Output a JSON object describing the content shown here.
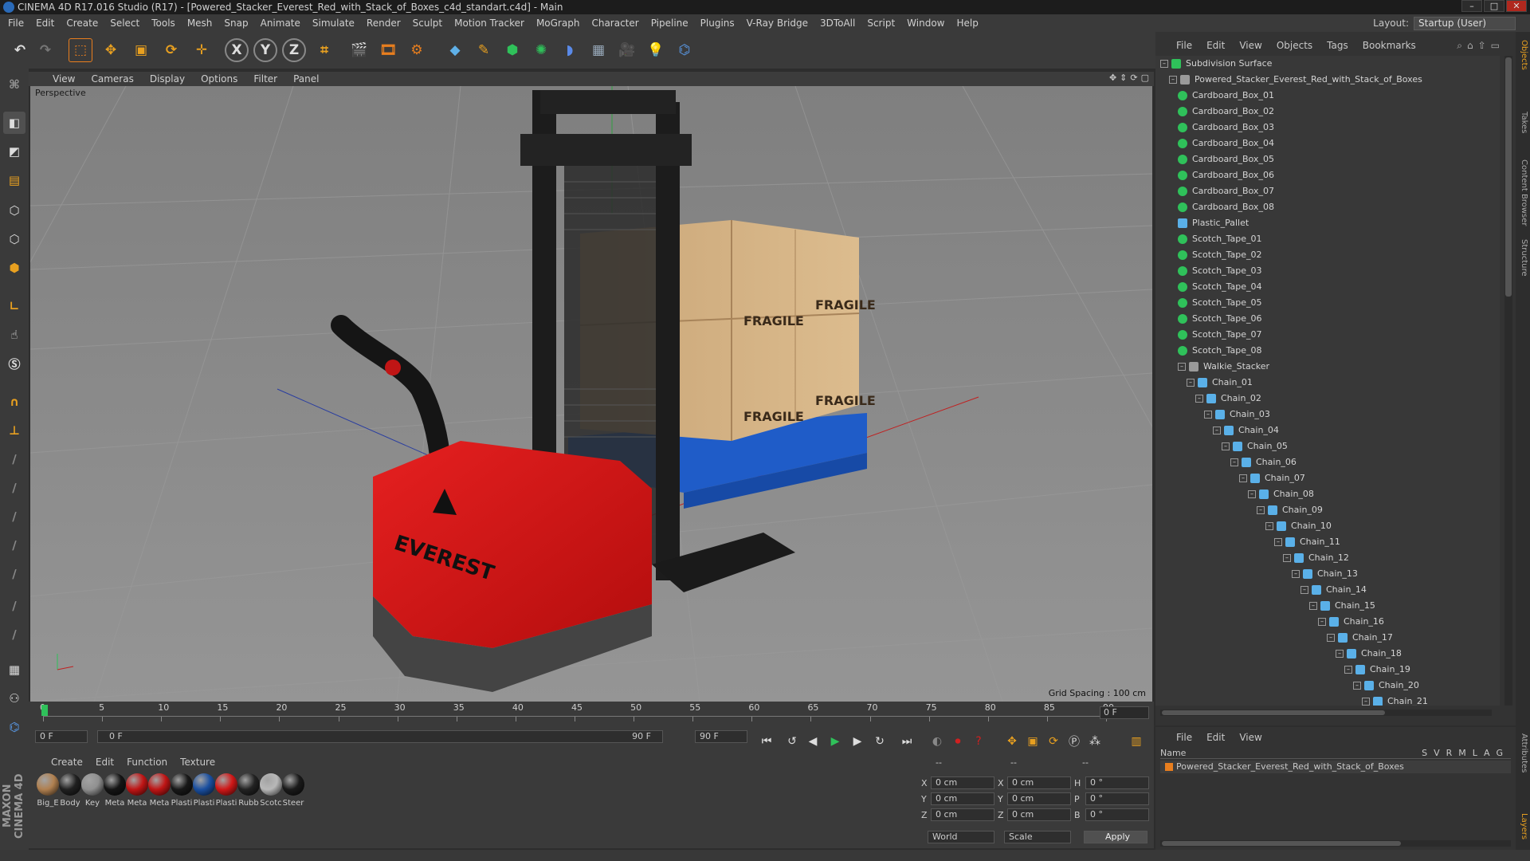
{
  "window": {
    "title": "CINEMA 4D R17.016 Studio (R17) - [Powered_Stacker_Everest_Red_with_Stack_of_Boxes_c4d_standart.c4d] - Main"
  },
  "menu": [
    "File",
    "Edit",
    "Create",
    "Select",
    "Tools",
    "Mesh",
    "Snap",
    "Animate",
    "Simulate",
    "Render",
    "Sculpt",
    "Motion Tracker",
    "MoGraph",
    "Character",
    "Pipeline",
    "Plugins",
    "V-Ray Bridge",
    "3DToAll",
    "Script",
    "Window",
    "Help"
  ],
  "layout": {
    "label": "Layout:",
    "value": "Startup (User)"
  },
  "toolbar": {
    "axis_x": "X",
    "axis_y": "Y",
    "axis_z": "Z"
  },
  "viewport": {
    "menu": [
      "View",
      "Cameras",
      "Display",
      "Options",
      "Filter",
      "Panel"
    ],
    "label": "Perspective",
    "grid_spacing": "Grid Spacing : 100 cm",
    "box_label": "FRAGILE",
    "brand": "EVEREST"
  },
  "timeline": {
    "ticks": [
      "0",
      "5",
      "10",
      "15",
      "20",
      "25",
      "30",
      "35",
      "40",
      "45",
      "50",
      "55",
      "60",
      "65",
      "70",
      "75",
      "80",
      "85",
      "90"
    ],
    "frame": "0 F"
  },
  "transport": {
    "start": "0 F",
    "range_start": "0 F",
    "range_end": "90 F",
    "end": "90 F"
  },
  "materials": {
    "menu": [
      "Create",
      "Edit",
      "Function",
      "Texture"
    ],
    "items": [
      {
        "label": "Big_E",
        "color": "#b08050"
      },
      {
        "label": "Body",
        "color": "#202020"
      },
      {
        "label": "Key",
        "color": "#909090"
      },
      {
        "label": "Meta",
        "color": "#151515"
      },
      {
        "label": "Meta",
        "color": "#c01515"
      },
      {
        "label": "Meta",
        "color": "#c01515"
      },
      {
        "label": "Plasti",
        "color": "#181818"
      },
      {
        "label": "Plasti",
        "color": "#1a4fa0"
      },
      {
        "label": "Plasti",
        "color": "#d01818"
      },
      {
        "label": "Rubb",
        "color": "#222222"
      },
      {
        "label": "Scotc",
        "color": "#b8b8b8"
      },
      {
        "label": "Steer",
        "color": "#1a1a1a"
      }
    ]
  },
  "coords": {
    "header": [
      "--",
      "--",
      "--"
    ],
    "rows": [
      {
        "a": "X",
        "av": "0 cm",
        "b": "X",
        "bv": "0 cm",
        "c": "H",
        "cv": "0 °"
      },
      {
        "a": "Y",
        "av": "0 cm",
        "b": "Y",
        "bv": "0 cm",
        "c": "P",
        "cv": "0 °"
      },
      {
        "a": "Z",
        "av": "0 cm",
        "b": "Z",
        "bv": "0 cm",
        "c": "B",
        "cv": "0 °"
      }
    ],
    "world": "World",
    "scale": "Scale",
    "apply": "Apply"
  },
  "objects": {
    "menu": [
      "File",
      "Edit",
      "View",
      "Objects",
      "Tags",
      "Bookmarks"
    ],
    "items": [
      {
        "label": "Subdivision Surface",
        "depth": 0,
        "icon": "sds"
      },
      {
        "label": "Powered_Stacker_Everest_Red_with_Stack_of_Boxes",
        "depth": 1,
        "icon": "null"
      },
      {
        "label": "Cardboard_Box_01",
        "depth": 2,
        "icon": "poly"
      },
      {
        "label": "Cardboard_Box_02",
        "depth": 2,
        "icon": "poly"
      },
      {
        "label": "Cardboard_Box_03",
        "depth": 2,
        "icon": "poly"
      },
      {
        "label": "Cardboard_Box_04",
        "depth": 2,
        "icon": "poly"
      },
      {
        "label": "Cardboard_Box_05",
        "depth": 2,
        "icon": "poly"
      },
      {
        "label": "Cardboard_Box_06",
        "depth": 2,
        "icon": "poly"
      },
      {
        "label": "Cardboard_Box_07",
        "depth": 2,
        "icon": "poly"
      },
      {
        "label": "Cardboard_Box_08",
        "depth": 2,
        "icon": "poly"
      },
      {
        "label": "Plastic_Pallet",
        "depth": 2,
        "icon": "bone"
      },
      {
        "label": "Scotch_Tape_01",
        "depth": 2,
        "icon": "poly"
      },
      {
        "label": "Scotch_Tape_02",
        "depth": 2,
        "icon": "poly"
      },
      {
        "label": "Scotch_Tape_03",
        "depth": 2,
        "icon": "poly"
      },
      {
        "label": "Scotch_Tape_04",
        "depth": 2,
        "icon": "poly"
      },
      {
        "label": "Scotch_Tape_05",
        "depth": 2,
        "icon": "poly"
      },
      {
        "label": "Scotch_Tape_06",
        "depth": 2,
        "icon": "poly"
      },
      {
        "label": "Scotch_Tape_07",
        "depth": 2,
        "icon": "poly"
      },
      {
        "label": "Scotch_Tape_08",
        "depth": 2,
        "icon": "poly"
      },
      {
        "label": "Walkie_Stacker",
        "depth": 2,
        "icon": "null"
      },
      {
        "label": "Chain_01",
        "depth": 3,
        "icon": "bone"
      },
      {
        "label": "Chain_02",
        "depth": 4,
        "icon": "bone"
      },
      {
        "label": "Chain_03",
        "depth": 5,
        "icon": "bone"
      },
      {
        "label": "Chain_04",
        "depth": 6,
        "icon": "bone"
      },
      {
        "label": "Chain_05",
        "depth": 7,
        "icon": "bone"
      },
      {
        "label": "Chain_06",
        "depth": 8,
        "icon": "bone"
      },
      {
        "label": "Chain_07",
        "depth": 9,
        "icon": "bone"
      },
      {
        "label": "Chain_08",
        "depth": 10,
        "icon": "bone"
      },
      {
        "label": "Chain_09",
        "depth": 11,
        "icon": "bone"
      },
      {
        "label": "Chain_10",
        "depth": 12,
        "icon": "bone"
      },
      {
        "label": "Chain_11",
        "depth": 13,
        "icon": "bone"
      },
      {
        "label": "Chain_12",
        "depth": 14,
        "icon": "bone"
      },
      {
        "label": "Chain_13",
        "depth": 15,
        "icon": "bone"
      },
      {
        "label": "Chain_14",
        "depth": 16,
        "icon": "bone"
      },
      {
        "label": "Chain_15",
        "depth": 17,
        "icon": "bone"
      },
      {
        "label": "Chain_16",
        "depth": 18,
        "icon": "bone"
      },
      {
        "label": "Chain_17",
        "depth": 19,
        "icon": "bone"
      },
      {
        "label": "Chain_18",
        "depth": 20,
        "icon": "bone"
      },
      {
        "label": "Chain_19",
        "depth": 21,
        "icon": "bone"
      },
      {
        "label": "Chain_20",
        "depth": 22,
        "icon": "bone"
      },
      {
        "label": "Chain_21",
        "depth": 23,
        "icon": "bone"
      }
    ]
  },
  "layers": {
    "menu": [
      "File",
      "Edit",
      "View"
    ],
    "header": {
      "name": "Name",
      "cols": [
        "S",
        "V",
        "R",
        "M",
        "L",
        "A",
        "G"
      ]
    },
    "row": "Powered_Stacker_Everest_Red_with_Stack_of_Boxes"
  },
  "sidetabs": [
    "Objects",
    "Takes",
    "Content Browser",
    "Structure",
    "Attributes",
    "Layers"
  ],
  "colors": {
    "accent": "#e87e1e",
    "axis_blue": "#2a6ab8",
    "axis_green": "#2fc15a"
  }
}
